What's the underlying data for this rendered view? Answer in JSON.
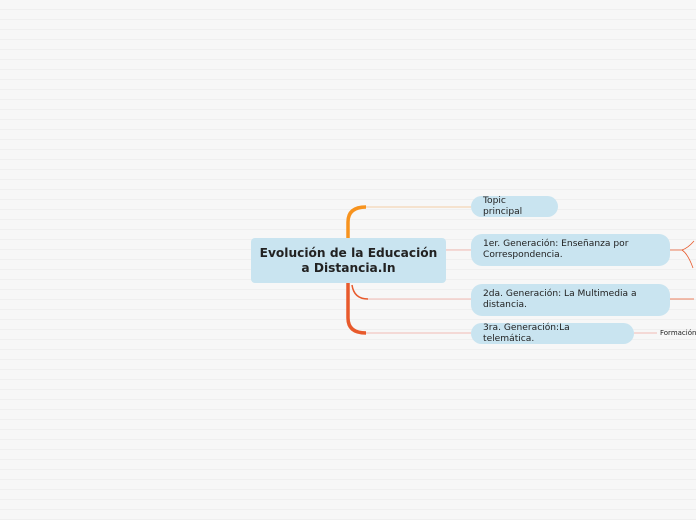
{
  "central": {
    "title": "Evolución de la Educación a Distancia.In"
  },
  "topics": [
    {
      "label": "Topic principal",
      "color": "#f2a14a"
    },
    {
      "label": "1er. Generación: Enseñanza por Correspondencia.",
      "color": "#f0a79e"
    },
    {
      "label": "2da. Generación: La Multimedia a distancia.",
      "color": "#f0a79e"
    },
    {
      "label": "3ra. Generación:La telemática.",
      "color": "#f0a79e"
    }
  ],
  "subtopics": [
    {
      "label": "Formación"
    }
  ],
  "colors": {
    "node_fill": "#c9e4f0",
    "branch_orange": "#f7931e",
    "branch_red": "#e85a2c",
    "connector_light": "#f0a79e"
  }
}
